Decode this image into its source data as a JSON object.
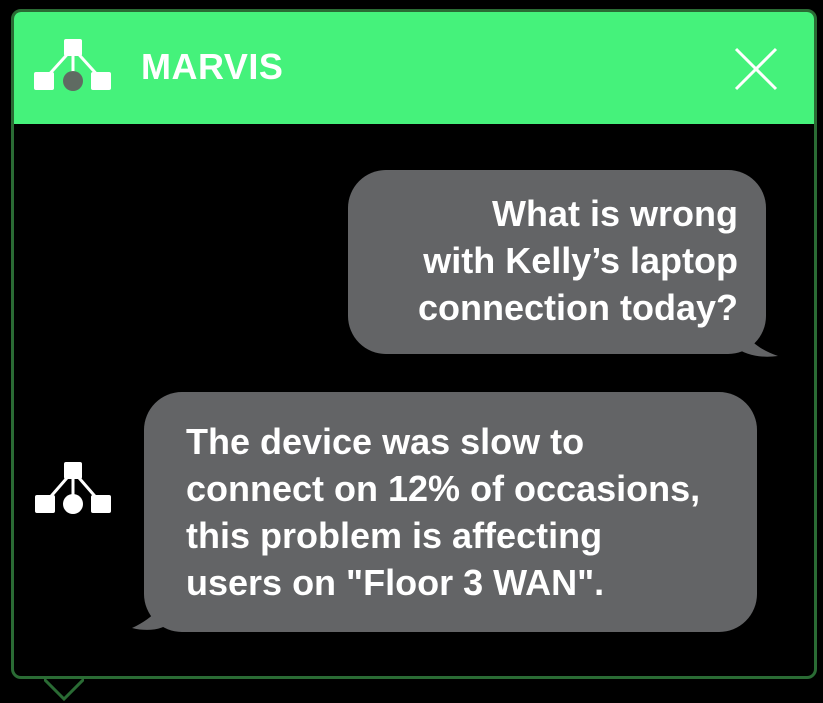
{
  "header": {
    "title": "MARVIS",
    "logo_icon": "network-topology-icon",
    "close_icon": "close-icon",
    "background_color": "#45f27b"
  },
  "conversation": {
    "messages": [
      {
        "sender": "user",
        "text": "What is wrong\nwith Kelly’s laptop\nconnection today?"
      },
      {
        "sender": "assistant",
        "avatar_icon": "network-topology-icon",
        "text": "The device was slow to\nconnect on 12% of occasions,\nthis problem is affecting\nusers on \"Floor 3 WAN\"."
      }
    ]
  },
  "colors": {
    "bubble": "#636466",
    "border": "#2a6b34",
    "background": "#000000"
  }
}
